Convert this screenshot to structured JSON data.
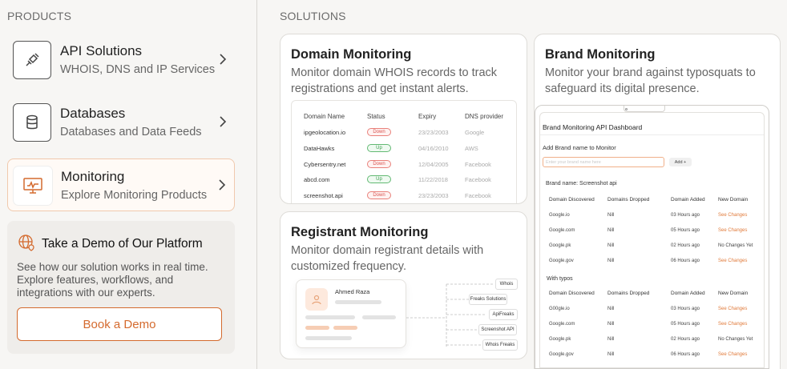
{
  "products": {
    "label": "PRODUCTS",
    "items": [
      {
        "title": "API Solutions",
        "subtitle": "WHOIS, DNS and IP Services",
        "icon": "plug-icon"
      },
      {
        "title": "Databases",
        "subtitle": "Databases and Data Feeds",
        "icon": "database-icon"
      },
      {
        "title": "Monitoring",
        "subtitle": "Explore Monitoring Products",
        "icon": "monitor-icon"
      }
    ]
  },
  "demo": {
    "title": "Take a Demo of Our Platform",
    "text": "See how our solution works in real time. Explore features, workflows, and integrations with our experts.",
    "button": "Book a Demo"
  },
  "solutions": {
    "label": "SOLUTIONS",
    "domain": {
      "title": "Domain Monitoring",
      "desc": "Monitor domain WHOIS records to track registrations and get instant alerts.",
      "headers": [
        "Domain Name",
        "Status",
        "Expiry",
        "DNS provider"
      ],
      "rows": [
        {
          "domain": "ipgeolocation.io",
          "status": "Down",
          "expiry": "23/23/2003",
          "dns": "Google"
        },
        {
          "domain": "DataHawks",
          "status": "Up",
          "expiry": "04/16/2010",
          "dns": "AWS"
        },
        {
          "domain": "Cybersentry.net",
          "status": "Down",
          "expiry": "12/04/2005",
          "dns": "Facebook"
        },
        {
          "domain": "abcd.com",
          "status": "Up",
          "expiry": "11/22/2018",
          "dns": "Facebook"
        },
        {
          "domain": "screenshot.api",
          "status": "Down",
          "expiry": "23/23/2003",
          "dns": "Facebook"
        }
      ]
    },
    "registrant": {
      "title": "Registrant Monitoring",
      "desc": "Monitor domain registrant details with customized frequency.",
      "name": "Ahmed Raza",
      "tags": [
        "Whois",
        "Freaks Solutions",
        "ApiFreaks",
        "Screenshot API",
        "Whois Freaks"
      ]
    },
    "brand": {
      "title": "Brand Monitoring",
      "desc": "Monitor your brand against typosquats to safeguard its digital presence.",
      "dashboard_title": "Brand Monitoring API Dashboard",
      "add_label": "Add Brand name to Monitor",
      "input_placeholder": "Enter your brand name here",
      "add_button": "Add +",
      "brand_name": "Brand name: Screenshot api",
      "headers": [
        "Domain Discovered",
        "Domains Dropped",
        "Domain Added",
        "New Domain"
      ],
      "rows": [
        {
          "d": "Google.io",
          "dropped": "Nill",
          "added": "03 Hours ago",
          "nd": "See Changes",
          "link": true
        },
        {
          "d": "Google.com",
          "dropped": "Nill",
          "added": "05 Hours ago",
          "nd": "See Changes",
          "link": true
        },
        {
          "d": "Google.pk",
          "dropped": "Nill",
          "added": "02 Hours ago",
          "nd": "No Changes Yet",
          "link": false
        },
        {
          "d": "Google.gov",
          "dropped": "Nill",
          "added": "06 Hours ago",
          "nd": "See Changes",
          "link": true
        }
      ],
      "typos_label": "With typos",
      "typo_rows": [
        {
          "d": "G00gle.io",
          "dropped": "Nill",
          "added": "03 Hours ago",
          "nd": "See Changes",
          "link": true
        },
        {
          "d": "Google.com",
          "dropped": "Nill",
          "added": "05 Hours ago",
          "nd": "See Changes",
          "link": true
        },
        {
          "d": "Google.pk",
          "dropped": "Nill",
          "added": "02 Hours ago",
          "nd": "No Changes Yet",
          "link": false
        },
        {
          "d": "Google.gov",
          "dropped": "Nill",
          "added": "06 Hours ago",
          "nd": "See Changes",
          "link": true
        }
      ]
    }
  },
  "colors": {
    "accent": "#d46a2e",
    "up": "#3a9b4d",
    "down": "#d9534f"
  }
}
